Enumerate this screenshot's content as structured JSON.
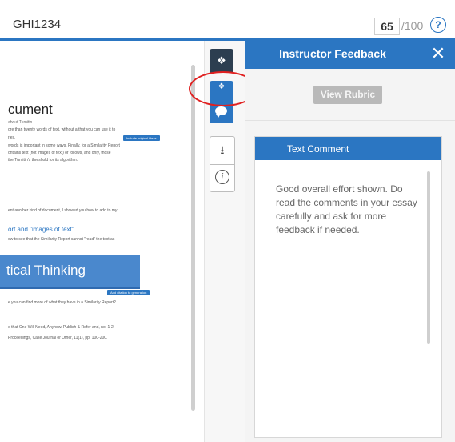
{
  "header": {
    "document_id": "GHI1234",
    "score": "65",
    "score_total": "/100",
    "help_icon": "?"
  },
  "document": {
    "title": "cument",
    "byline": "about Turnitin",
    "lines": [
      "ore than twenty words of text, without a that you can use it to",
      "ries.",
      "words is important in some ways. Finally, for a Similarity Report",
      "ontains text (not images of text) or follows, and only, those",
      "the Turnitin's threshold for its algorithm.",
      "ent another kind of document, I showed you how to add to my",
      "ow to see that the Similarity Report cannot \"read\" the text as",
      "e you can find more of what they have in a Similarity Report?",
      "e that One Will Need, Anyhow. Publish & Refer and, no. 1-2",
      "Proceedings, Case Journal or Other, 11(1), pp. 100-200."
    ],
    "link_text": "ort and \"images of text\"",
    "buttons": [
      "Include original ideas",
      "Add citation to generation"
    ],
    "banner_text": "tical Thinking"
  },
  "rail": {
    "layers_icon": "layers-icon",
    "active_icon": "layers-icon",
    "comment_icon": "comment-icon",
    "download_glyph": "⭳",
    "info_glyph": "i"
  },
  "panel": {
    "title": "Instructor Feedback",
    "close_glyph": "✕",
    "rubric_button": "View Rubric",
    "text_comment": {
      "title": "Text Comment",
      "body": "Good overall effort shown. Do read the comments in your essay carefully and ask for more feedback if needed."
    }
  },
  "colors": {
    "accent": "#2b76c2",
    "highlight_ring": "#e02020",
    "rail_dark": "#2c3e50"
  }
}
